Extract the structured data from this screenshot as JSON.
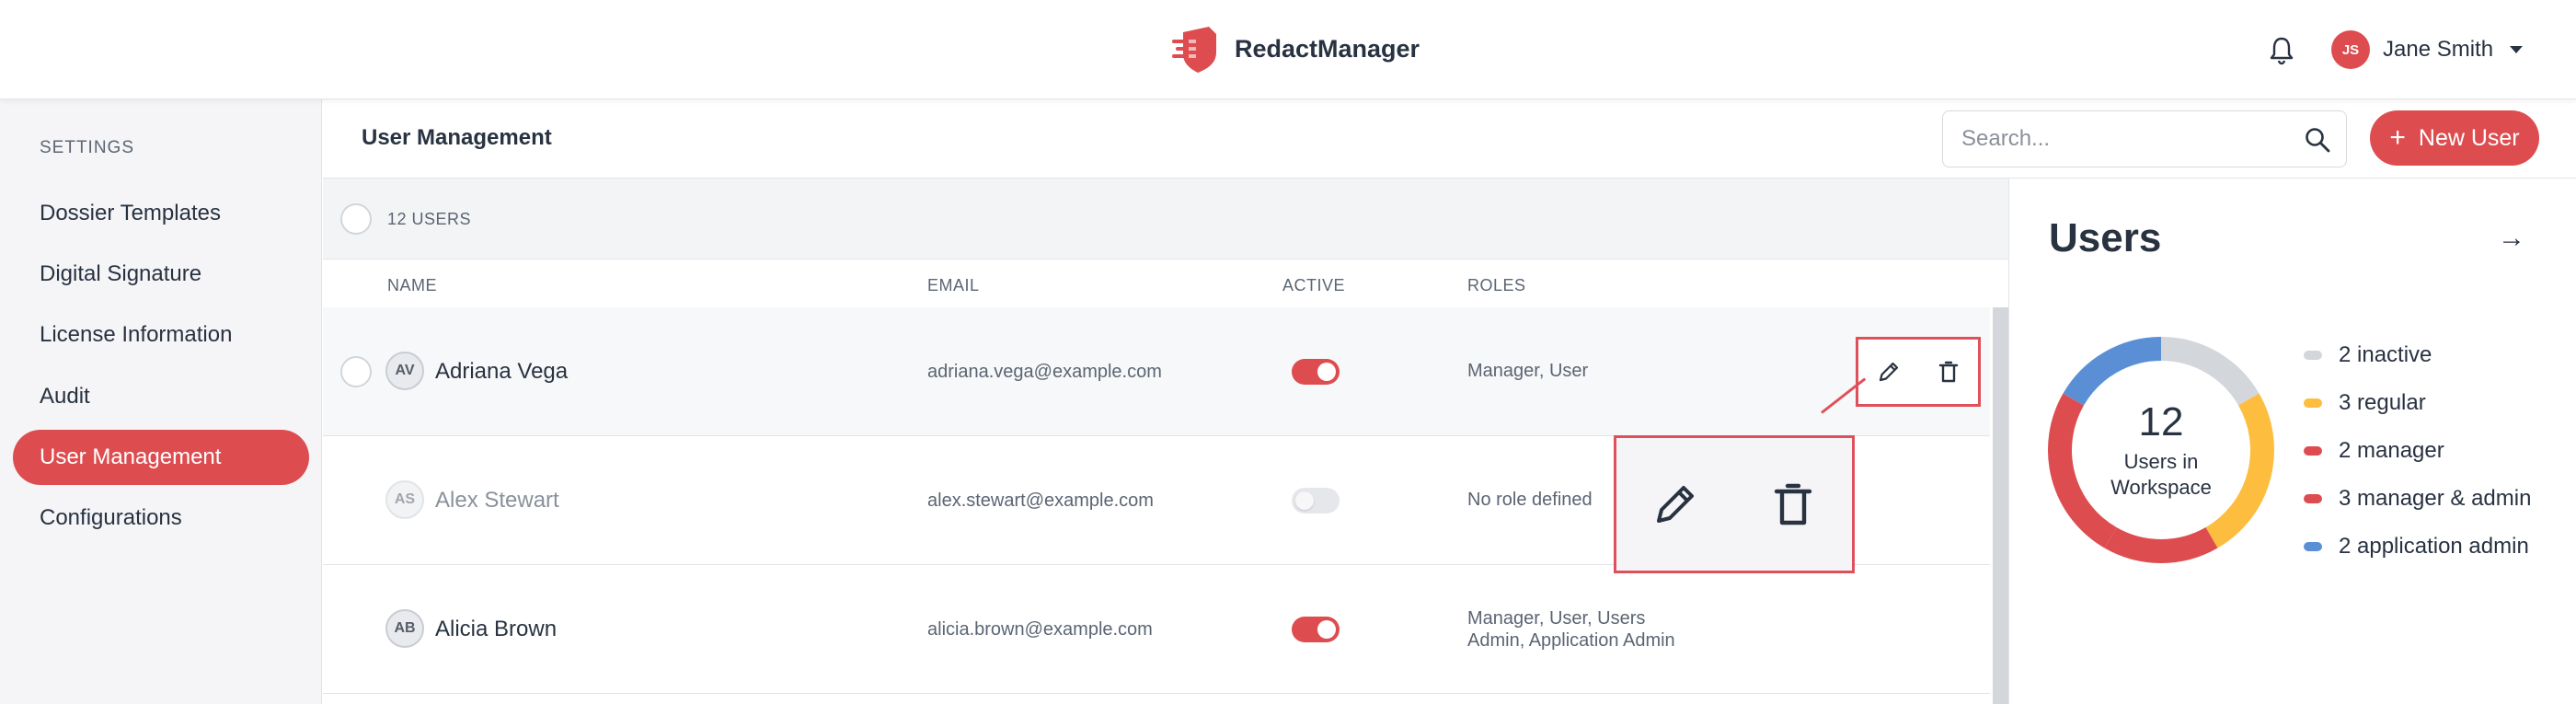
{
  "app": {
    "brand_name": "RedactManager",
    "brand_color": "#dd4d50"
  },
  "header": {
    "user_initials": "JS",
    "user_name": "Jane Smith"
  },
  "sidebar": {
    "heading": "SETTINGS",
    "items": [
      {
        "label": "Dossier Templates",
        "active": false
      },
      {
        "label": "Digital Signature",
        "active": false
      },
      {
        "label": "License Information",
        "active": false
      },
      {
        "label": "Audit",
        "active": false
      },
      {
        "label": "User Management",
        "active": true
      },
      {
        "label": "Configurations",
        "active": false
      }
    ]
  },
  "main": {
    "title": "User Management",
    "search_placeholder": "Search...",
    "new_user_label": "New User",
    "count_label": "12 USERS",
    "columns": [
      "NAME",
      "EMAIL",
      "ACTIVE",
      "ROLES"
    ],
    "rows": [
      {
        "initials": "AV",
        "name": "Adriana Vega",
        "email": "adriana.vega@example.com",
        "active": true,
        "roles_line1": "Manager, User",
        "roles_line2": ""
      },
      {
        "initials": "AS",
        "name": "Alex Stewart",
        "email": "alex.stewart@example.com",
        "active": false,
        "roles_line1": "No role defined",
        "roles_line2": ""
      },
      {
        "initials": "AB",
        "name": "Alicia Brown",
        "email": "alicia.brown@example.com",
        "active": true,
        "roles_line1": "Manager, User, Users",
        "roles_line2": "Admin, Application Admin"
      }
    ]
  },
  "panel": {
    "title": "Users",
    "total": "12",
    "total_label_line1": "Users in",
    "total_label_line2": "Workspace",
    "legend": [
      {
        "label": "2 inactive",
        "value": 2,
        "color": "#d3d6da"
      },
      {
        "label": "3 regular",
        "value": 3,
        "color": "#fdbd3f"
      },
      {
        "label": "2 manager",
        "value": 2,
        "color": "#dd4d50"
      },
      {
        "label": "3 manager & admin",
        "value": 3,
        "color": "#dd4d50"
      },
      {
        "label": "2 application admin",
        "value": 2,
        "color": "#5a8fd6"
      }
    ]
  }
}
